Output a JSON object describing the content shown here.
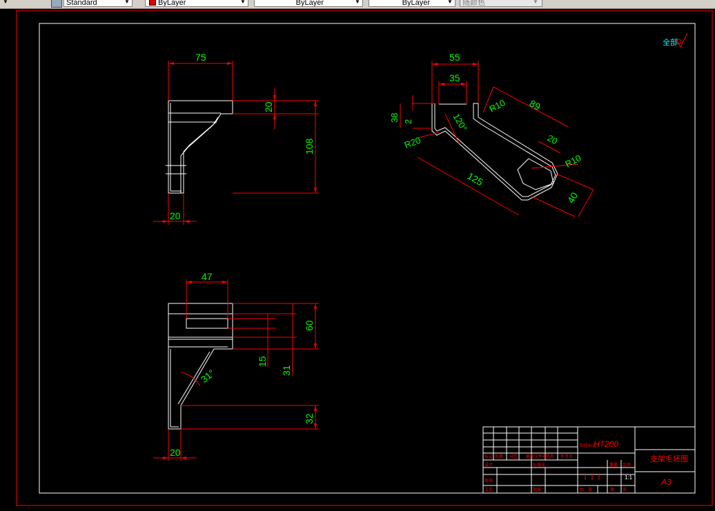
{
  "toolbar": {
    "textstyle": "Standard",
    "color": "ByLayer",
    "linetype": "ByLayer",
    "lineweight": "ByLayer",
    "plotstyle": "随颜色",
    "accent_red": "#e00000"
  },
  "drawing": {
    "colors": {
      "outline": "#ffffff",
      "dimension": "#ff0000",
      "text": "#00ff00",
      "title_text": "#ff0000",
      "roughness": "#00ffff"
    },
    "top_view": {
      "width_top": "75",
      "height_flange": "20",
      "total_height": "108",
      "base_width": "20"
    },
    "iso_view": {
      "slot_outer": "55",
      "slot_inner": "35",
      "left_height": "38",
      "small_gap": "2",
      "angle": "120°",
      "radius_large": "R20",
      "radius_top": "R10",
      "arm_length": "89",
      "slot_width": "20",
      "radius_slot": "R10",
      "overall_length": "125",
      "end_width": "40"
    },
    "front_view": {
      "slot_width": "47",
      "right_height": "60",
      "inner_height": "15",
      "mid_height": "31",
      "angle": "31°",
      "bottom_height": "32",
      "base_width": "20"
    },
    "roughness_note": "全部"
  },
  "title_block": {
    "material": "HT200",
    "part_name": "支架毛坯图",
    "sheet_size": "A3",
    "scale": "1:1",
    "cells": [
      "标记",
      "处数",
      "分区",
      "更改文件号",
      "签名",
      "年月日",
      "设计",
      "标准化",
      "阶段标记",
      "重量",
      "比例",
      "审核",
      "工艺",
      "批准",
      "共",
      "张",
      "第",
      "张"
    ]
  }
}
